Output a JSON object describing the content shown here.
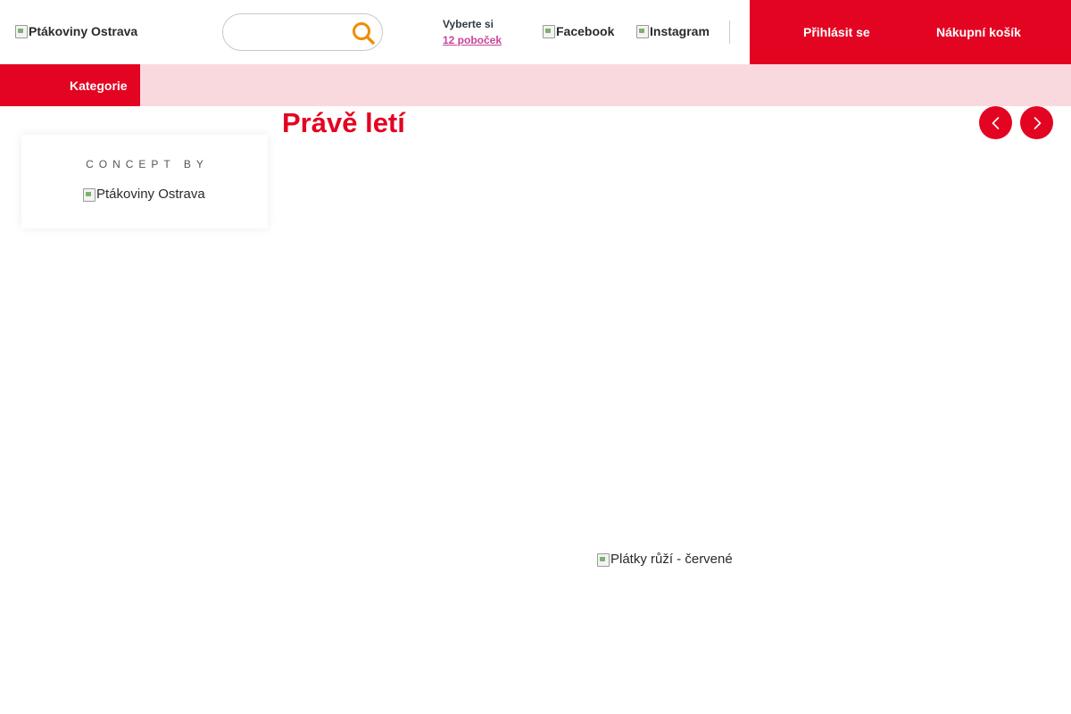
{
  "header": {
    "logo_alt": "Ptákoviny Ostrava",
    "search": {
      "placeholder": "",
      "value": ""
    },
    "branches": {
      "line1": "Vyberte si",
      "line2": "12 poboček"
    },
    "social": {
      "facebook": "Facebook",
      "instagram": "Instagram"
    },
    "login_label": "Přihlásit se",
    "cart_label": "Nákupní košík"
  },
  "nav": {
    "categories_label": "Kategorie"
  },
  "sidebar": {
    "concept_label": "CONCEPT BY",
    "concept_logo_alt": "Ptákoviny Ostrava"
  },
  "main": {
    "title": "Právě letí",
    "product_image_alt": "Plátky růží - červené"
  },
  "icons": {
    "search": "search-icon",
    "prev": "chevron-left-icon",
    "next": "chevron-right-icon",
    "broken_image": "broken-image-icon"
  },
  "colors": {
    "brand_red": "#e30422",
    "nav_pink": "#fad9de",
    "search_orange": "#f08c00",
    "link_pink": "#c7469a"
  }
}
